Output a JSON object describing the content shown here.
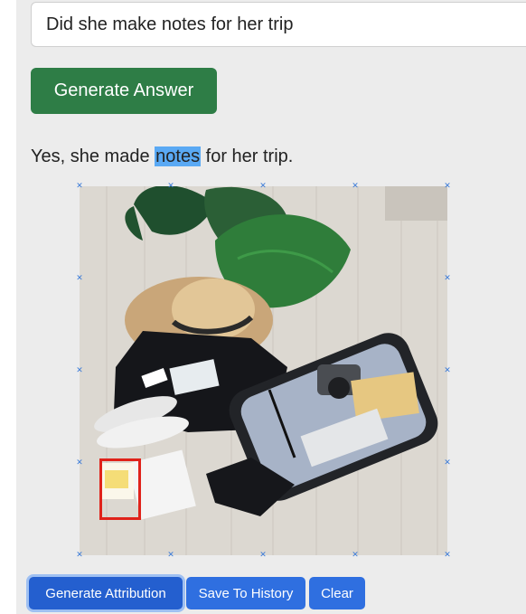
{
  "question": {
    "value": "Did she make notes for her trip"
  },
  "generate_answer_label": "Generate Answer",
  "answer": {
    "before": "Yes, she made ",
    "highlight": "notes",
    "after": " for her trip."
  },
  "image": {
    "alt": "Flat-lay of an open suitcase with a straw hat, sneakers, camera and notebook under a large green leaf",
    "grid_marker_icon": "cross-marker-icon",
    "attribution_box_color": "#e0221a"
  },
  "buttons": {
    "generate_attribution": "Generate Attribution",
    "save_to_history": "Save To History",
    "clear": "Clear"
  },
  "colors": {
    "panel_bg": "#ececec",
    "answer_button": "#2e7d46",
    "action_button": "#2f6fe0",
    "highlight": "#5aa9f4"
  }
}
